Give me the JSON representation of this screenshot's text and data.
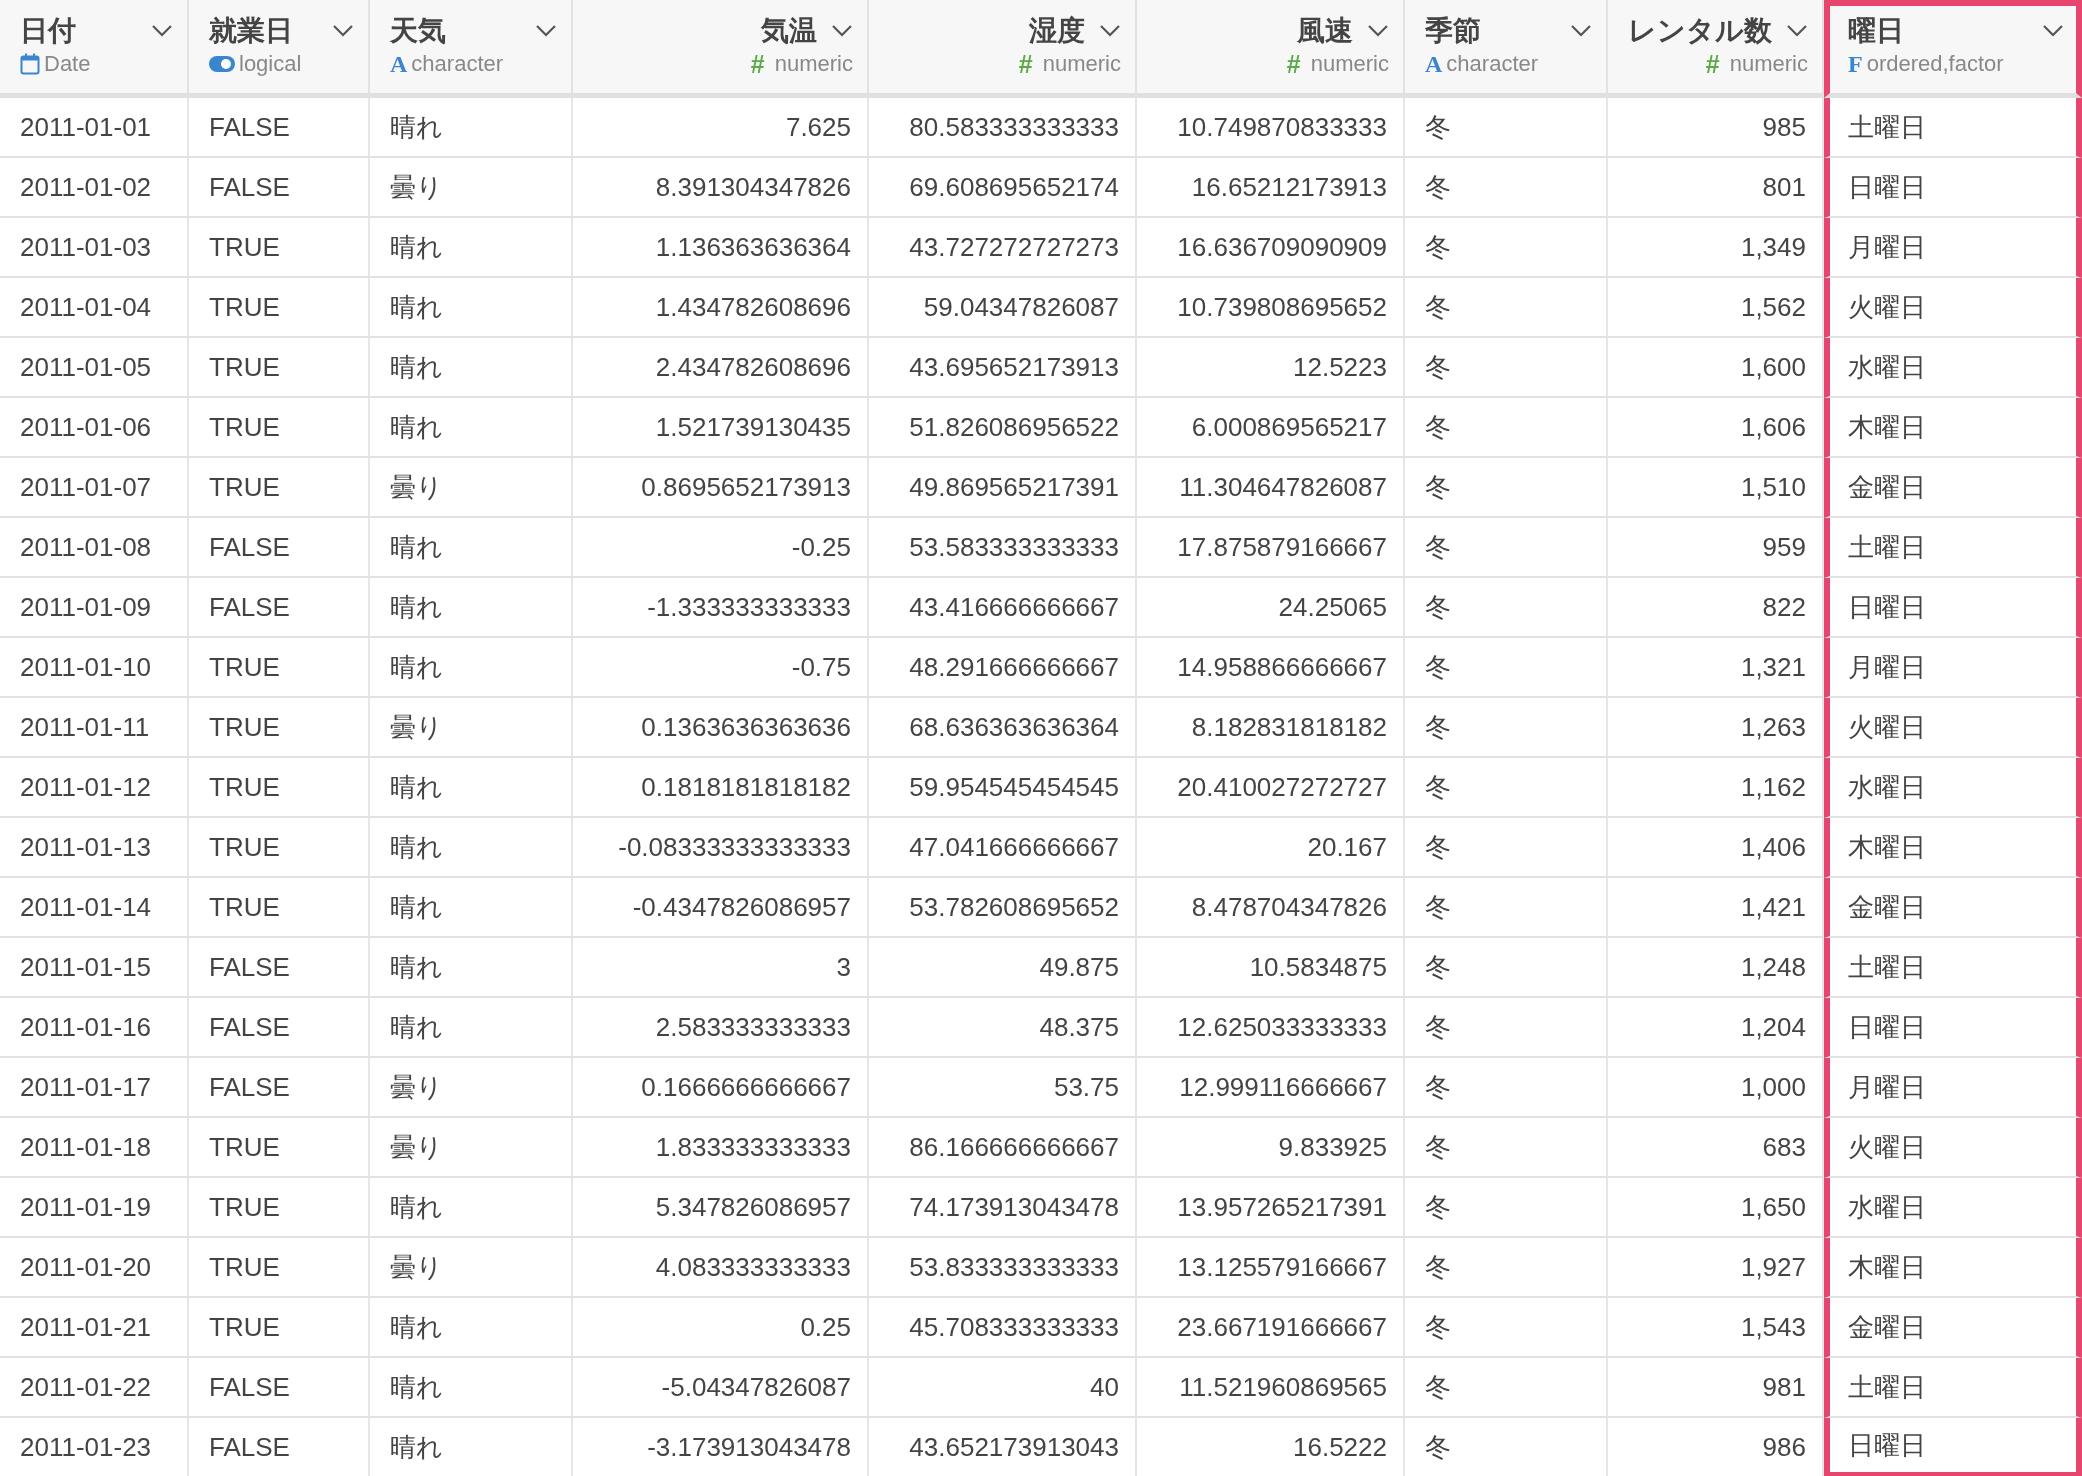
{
  "table": {
    "columns": [
      {
        "label": "日付",
        "type_label": "Date",
        "kind": "date",
        "selected": false
      },
      {
        "label": "就業日",
        "type_label": "logical",
        "kind": "logical",
        "selected": false
      },
      {
        "label": "天気",
        "type_label": "character",
        "kind": "character",
        "icon": "A",
        "selected": false
      },
      {
        "label": "気温",
        "type_label": "numeric",
        "kind": "numeric",
        "icon": "#",
        "selected": false
      },
      {
        "label": "湿度",
        "type_label": "numeric",
        "kind": "numeric",
        "icon": "#",
        "selected": false
      },
      {
        "label": "風速",
        "type_label": "numeric",
        "kind": "numeric",
        "icon": "#",
        "selected": false
      },
      {
        "label": "季節",
        "type_label": "character",
        "kind": "character",
        "icon": "A",
        "selected": false
      },
      {
        "label": "レンタル数",
        "type_label": "numeric",
        "kind": "numeric",
        "icon": "#",
        "selected": false
      },
      {
        "label": "曜日",
        "type_label": "ordered,factor",
        "kind": "factor",
        "icon": "F",
        "selected": true
      }
    ],
    "rows": [
      [
        "2011-01-01",
        "FALSE",
        "晴れ",
        "7.625",
        "80.583333333333",
        "10.749870833333",
        "冬",
        "985",
        "土曜日"
      ],
      [
        "2011-01-02",
        "FALSE",
        "曇り",
        "8.391304347826",
        "69.608695652174",
        "16.65212173913",
        "冬",
        "801",
        "日曜日"
      ],
      [
        "2011-01-03",
        "TRUE",
        "晴れ",
        "1.136363636364",
        "43.727272727273",
        "16.636709090909",
        "冬",
        "1,349",
        "月曜日"
      ],
      [
        "2011-01-04",
        "TRUE",
        "晴れ",
        "1.434782608696",
        "59.04347826087",
        "10.739808695652",
        "冬",
        "1,562",
        "火曜日"
      ],
      [
        "2011-01-05",
        "TRUE",
        "晴れ",
        "2.434782608696",
        "43.695652173913",
        "12.5223",
        "冬",
        "1,600",
        "水曜日"
      ],
      [
        "2011-01-06",
        "TRUE",
        "晴れ",
        "1.521739130435",
        "51.826086956522",
        "6.000869565217",
        "冬",
        "1,606",
        "木曜日"
      ],
      [
        "2011-01-07",
        "TRUE",
        "曇り",
        "0.8695652173913",
        "49.869565217391",
        "11.304647826087",
        "冬",
        "1,510",
        "金曜日"
      ],
      [
        "2011-01-08",
        "FALSE",
        "晴れ",
        "-0.25",
        "53.583333333333",
        "17.875879166667",
        "冬",
        "959",
        "土曜日"
      ],
      [
        "2011-01-09",
        "FALSE",
        "晴れ",
        "-1.333333333333",
        "43.416666666667",
        "24.25065",
        "冬",
        "822",
        "日曜日"
      ],
      [
        "2011-01-10",
        "TRUE",
        "晴れ",
        "-0.75",
        "48.291666666667",
        "14.958866666667",
        "冬",
        "1,321",
        "月曜日"
      ],
      [
        "2011-01-11",
        "TRUE",
        "曇り",
        "0.1363636363636",
        "68.636363636364",
        "8.182831818182",
        "冬",
        "1,263",
        "火曜日"
      ],
      [
        "2011-01-12",
        "TRUE",
        "晴れ",
        "0.1818181818182",
        "59.954545454545",
        "20.410027272727",
        "冬",
        "1,162",
        "水曜日"
      ],
      [
        "2011-01-13",
        "TRUE",
        "晴れ",
        "-0.08333333333333",
        "47.041666666667",
        "20.167",
        "冬",
        "1,406",
        "木曜日"
      ],
      [
        "2011-01-14",
        "TRUE",
        "晴れ",
        "-0.4347826086957",
        "53.782608695652",
        "8.478704347826",
        "冬",
        "1,421",
        "金曜日"
      ],
      [
        "2011-01-15",
        "FALSE",
        "晴れ",
        "3",
        "49.875",
        "10.5834875",
        "冬",
        "1,248",
        "土曜日"
      ],
      [
        "2011-01-16",
        "FALSE",
        "晴れ",
        "2.583333333333",
        "48.375",
        "12.625033333333",
        "冬",
        "1,204",
        "日曜日"
      ],
      [
        "2011-01-17",
        "FALSE",
        "曇り",
        "0.1666666666667",
        "53.75",
        "12.999116666667",
        "冬",
        "1,000",
        "月曜日"
      ],
      [
        "2011-01-18",
        "TRUE",
        "曇り",
        "1.833333333333",
        "86.166666666667",
        "9.833925",
        "冬",
        "683",
        "火曜日"
      ],
      [
        "2011-01-19",
        "TRUE",
        "晴れ",
        "5.347826086957",
        "74.173913043478",
        "13.957265217391",
        "冬",
        "1,650",
        "水曜日"
      ],
      [
        "2011-01-20",
        "TRUE",
        "曇り",
        "4.083333333333",
        "53.833333333333",
        "13.125579166667",
        "冬",
        "1,927",
        "木曜日"
      ],
      [
        "2011-01-21",
        "TRUE",
        "晴れ",
        "0.25",
        "45.708333333333",
        "23.667191666667",
        "冬",
        "1,543",
        "金曜日"
      ],
      [
        "2011-01-22",
        "FALSE",
        "晴れ",
        "-5.04347826087",
        "40",
        "11.521960869565",
        "冬",
        "981",
        "土曜日"
      ],
      [
        "2011-01-23",
        "FALSE",
        "晴れ",
        "-3.173913043478",
        "43.652173913043",
        "16.5222",
        "冬",
        "986",
        "日曜日"
      ]
    ]
  }
}
